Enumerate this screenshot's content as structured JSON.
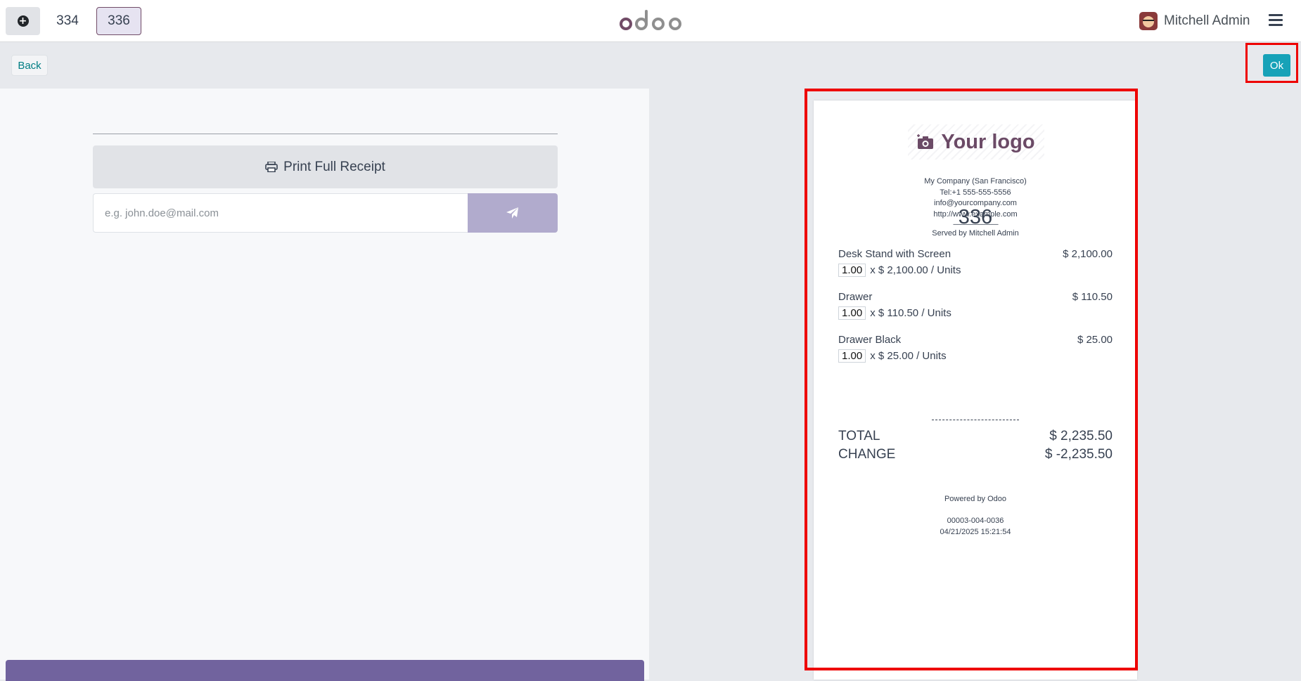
{
  "topbar": {
    "orders": [
      "334",
      "336"
    ],
    "active_order": "336",
    "brand": "odoo",
    "user_name": "Mitchell Admin"
  },
  "actions": {
    "back_label": "Back",
    "ok_label": "Ok"
  },
  "left": {
    "print_label": "Print Full Receipt",
    "email_placeholder": "e.g. john.doe@mail.com"
  },
  "receipt": {
    "logo_text": "Your logo",
    "company": "My Company (San Francisco)",
    "tel": "Tel:+1 555-555-5556",
    "email": "info@yourcompany.com",
    "website": "http://www.example.com",
    "small_dashes": "--------------------------------",
    "served_by": "Served by Mitchell Admin",
    "order_number": "336",
    "lines": [
      {
        "name": "Desk Stand with Screen",
        "price": "$ 2,100.00",
        "qty": "1.00",
        "unit_text": "x $ 2,100.00 / Units"
      },
      {
        "name": "Drawer",
        "price": "$ 110.50",
        "qty": "1.00",
        "unit_text": "x $ 110.50 / Units"
      },
      {
        "name": "Drawer Black",
        "price": "$ 25.00",
        "qty": "1.00",
        "unit_text": "x $ 25.00 / Units"
      }
    ],
    "total_label": "TOTAL",
    "total_value": "$ 2,235.50",
    "change_label": "CHANGE",
    "change_value": "$ -2,235.50",
    "powered_by": "Powered by Odoo",
    "reference": "00003-004-0036",
    "datetime": "04/21/2025 15:21:54"
  },
  "colors": {
    "accent": "#714b67",
    "ok_button": "#17a2b8",
    "send_button": "#b1abcd",
    "highlight_frame": "#ee0000",
    "bottom_bar": "#71639e"
  },
  "icons": [
    "plus-circle-icon",
    "odoo-logo",
    "user-avatar",
    "hamburger-menu-icon",
    "printer-icon",
    "paper-plane-icon",
    "camera-icon"
  ]
}
